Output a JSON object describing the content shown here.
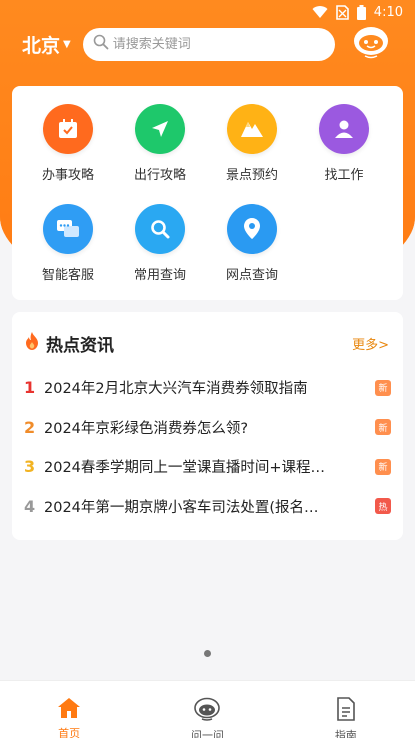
{
  "status_bar": {
    "time": "4:10"
  },
  "header": {
    "city": "北京",
    "search_placeholder": "请搜索关键词"
  },
  "services": [
    {
      "label": "办事攻略",
      "icon": "calendar-check-icon",
      "color": "#ff6a1e"
    },
    {
      "label": "出行攻略",
      "icon": "paper-plane-icon",
      "color": "#1ec86b"
    },
    {
      "label": "景点预约",
      "icon": "mountain-icon",
      "color": "#ffb215"
    },
    {
      "label": "找工作",
      "icon": "person-icon",
      "color": "#9b59e0"
    },
    {
      "label": "智能客服",
      "icon": "chat-bubbles-icon",
      "color": "#2f9df4"
    },
    {
      "label": "常用查询",
      "icon": "magnifier-icon",
      "color": "#2aa8f2"
    },
    {
      "label": "网点查询",
      "icon": "location-pin-icon",
      "color": "#2a9af2"
    }
  ],
  "news": {
    "title": "热点资讯",
    "more": "更多>",
    "items": [
      {
        "rank": "1",
        "text": "2024年2月北京大兴汽车消费券领取指南",
        "tag": "新",
        "tag_color": "#ff8f4e",
        "rank_color": "#e8332f"
      },
      {
        "rank": "2",
        "text": "2024年京彩绿色消费券怎么领?",
        "tag": "新",
        "tag_color": "#ff8f4e",
        "rank_color": "#f08c2a"
      },
      {
        "rank": "3",
        "text": "2024春季学期同上一堂课直播时间+课程…",
        "tag": "新",
        "tag_color": "#ff8f4e",
        "rank_color": "#f2b322"
      },
      {
        "rank": "4",
        "text": "2024年第一期京牌小客车司法处置(报名…",
        "tag": "热",
        "tag_color": "#f2594b",
        "rank_color": "#999999"
      }
    ]
  },
  "tabs": [
    {
      "label": "首页",
      "icon": "home-icon",
      "active": true
    },
    {
      "label": "问一问",
      "icon": "robot-face-icon",
      "active": false
    },
    {
      "label": "指南",
      "icon": "document-icon",
      "active": false
    }
  ],
  "colors": {
    "brand": "#ff7a12"
  }
}
